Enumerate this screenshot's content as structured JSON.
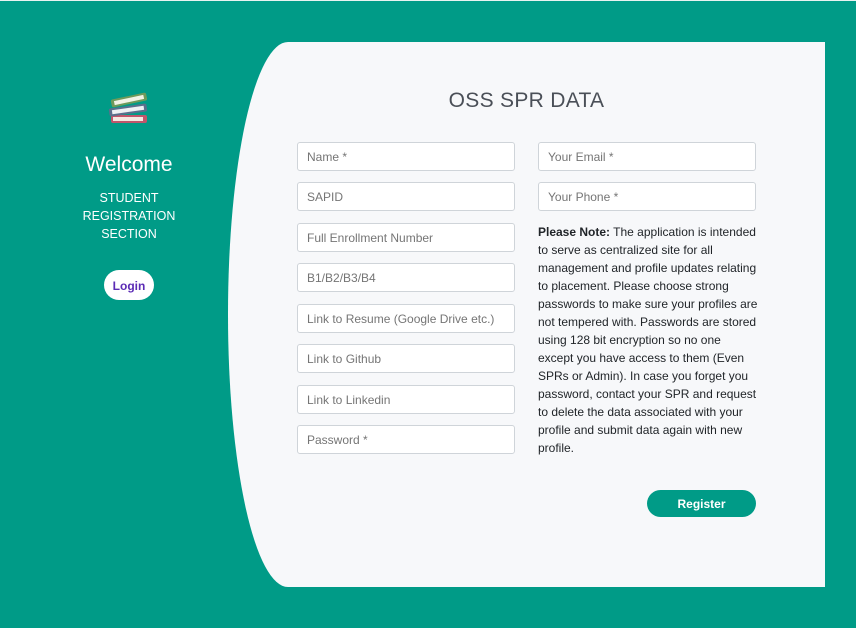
{
  "sidebar": {
    "icon": "books-icon",
    "welcome": "Welcome",
    "section_lines": [
      "STUDENT",
      "REGISTRATION",
      "SECTION"
    ],
    "login_label": "Login"
  },
  "form": {
    "title": "OSS SPR DATA",
    "left_fields": [
      {
        "placeholder": "Name *"
      },
      {
        "placeholder": "SAPID"
      },
      {
        "placeholder": "Full Enrollment Number"
      },
      {
        "placeholder": "B1/B2/B3/B4"
      },
      {
        "placeholder": "Link to Resume (Google Drive etc.)"
      },
      {
        "placeholder": "Link to Github"
      },
      {
        "placeholder": "Link to Linkedin"
      },
      {
        "placeholder": "Password *"
      }
    ],
    "right_fields": [
      {
        "placeholder": "Your Email *"
      },
      {
        "placeholder": "Your Phone *"
      }
    ],
    "note_label": "Please Note:",
    "note_text": "The application is intended to serve as centralized site for all management and profile updates relating to placement. Please choose strong passwords to make sure your profiles are not tempered with. Passwords are stored using 128 bit encryption so no one except you have access to them (Even SPRs or Admin). In case you forget you password, contact your SPR and request to delete the data associated with your profile and submit data again with new profile.",
    "register_label": "Register"
  },
  "colors": {
    "background": "#009b87",
    "card": "#f7f8fa",
    "login_text": "#5b2bb5"
  }
}
